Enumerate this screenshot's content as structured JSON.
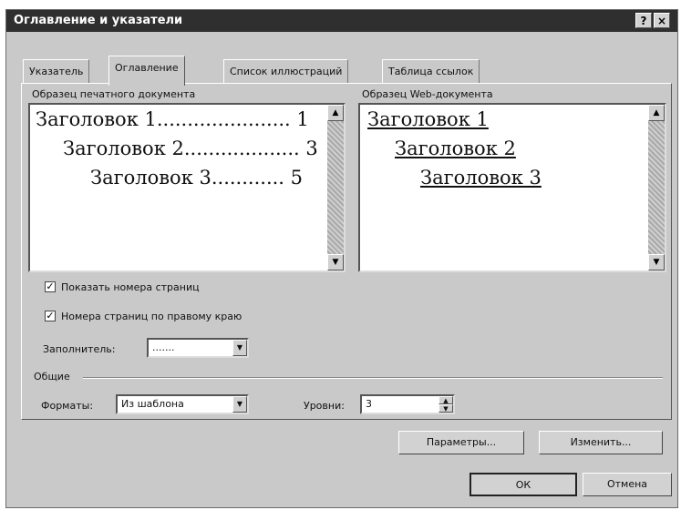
{
  "window": {
    "title": "Оглавление и указатели"
  },
  "titlebar_buttons": {
    "help": "?",
    "close": "×"
  },
  "tabs": [
    {
      "label": "Указатель"
    },
    {
      "label": "Оглавление"
    },
    {
      "label": "Список иллюстраций"
    },
    {
      "label": "Таблица ссылок"
    }
  ],
  "print_preview": {
    "label": "Образец печатного документа",
    "lines": [
      {
        "text": "Заголовок 1...................... 1"
      },
      {
        "text": "Заголовок 2................... 3"
      },
      {
        "text": "Заголовок 3............ 5"
      }
    ]
  },
  "web_preview": {
    "label": "Образец Web-документа",
    "lines": [
      {
        "text": "Заголовок 1"
      },
      {
        "text": "Заголовок 2"
      },
      {
        "text": "Заголовок 3"
      }
    ]
  },
  "options": {
    "show_page_numbers": {
      "label": "Показать номера страниц",
      "checked": true
    },
    "right_align": {
      "label": "Номера страниц по правому краю",
      "checked": true
    },
    "filler": {
      "label": "Заполнитель:",
      "value": "......."
    }
  },
  "general": {
    "group_label": "Общие",
    "formats_label": "Форматы:",
    "formats_value": "Из шаблона",
    "levels_label": "Уровни:",
    "levels_value": "3"
  },
  "buttons": {
    "params": "Параметры...",
    "modify": "Изменить...",
    "ok": "ОК",
    "cancel": "Отмена"
  },
  "icons": {
    "scroll_up": "▲",
    "scroll_down": "▼",
    "dropdown": "▼",
    "check": "✓"
  }
}
